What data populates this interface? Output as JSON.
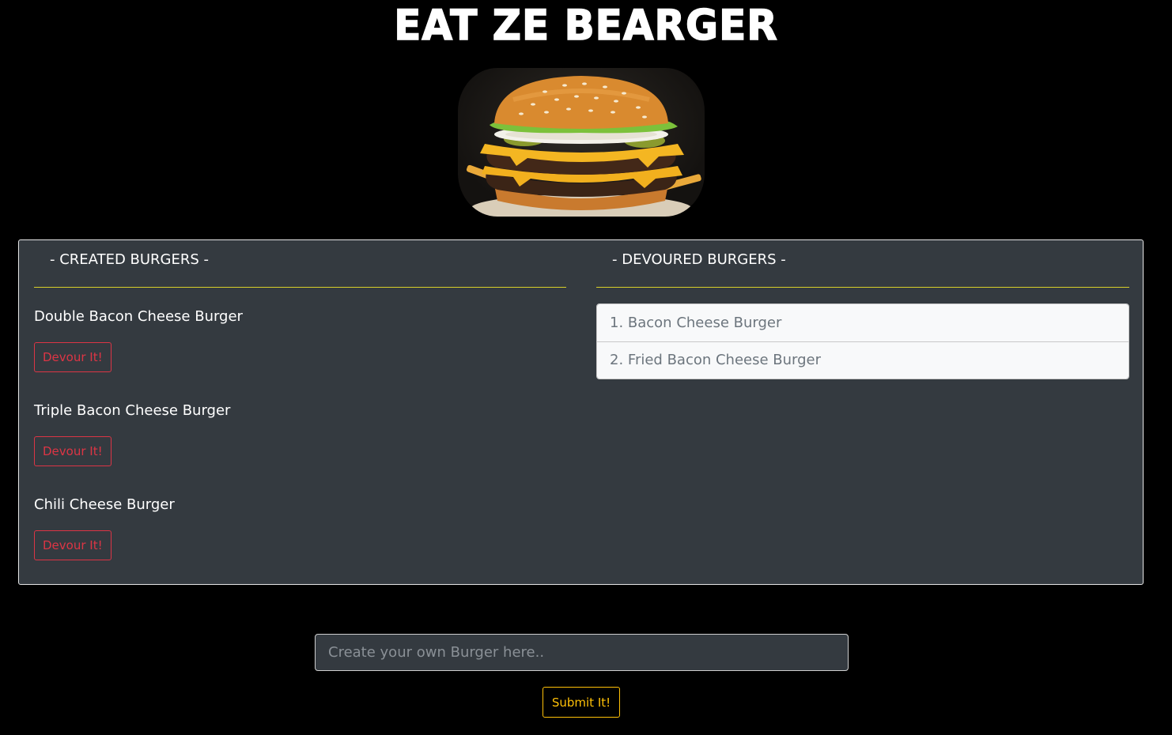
{
  "header": {
    "title": "EAT ZE BEARGER"
  },
  "hero_image": {
    "alt": "burger-image"
  },
  "created": {
    "heading": "- CREATED BURGERS -",
    "items": [
      {
        "name": "Double Bacon Cheese Burger",
        "button_label": "Devour It!"
      },
      {
        "name": "Triple Bacon Cheese Burger",
        "button_label": "Devour It!"
      },
      {
        "name": "Chili Cheese Burger",
        "button_label": "Devour It!"
      }
    ]
  },
  "devoured": {
    "heading": "- DEVOURED BURGERS -",
    "items": [
      {
        "label": "1. Bacon Cheese Burger"
      },
      {
        "label": "2. Fried Bacon Cheese Burger"
      }
    ]
  },
  "form": {
    "placeholder": "Create your own Burger here..",
    "value": "",
    "submit_label": "Submit It!"
  },
  "colors": {
    "page_bg": "#000000",
    "panel_bg": "#343a40",
    "divider": "#d8cf2a",
    "danger": "#dc3545",
    "warning": "#ffc107"
  }
}
